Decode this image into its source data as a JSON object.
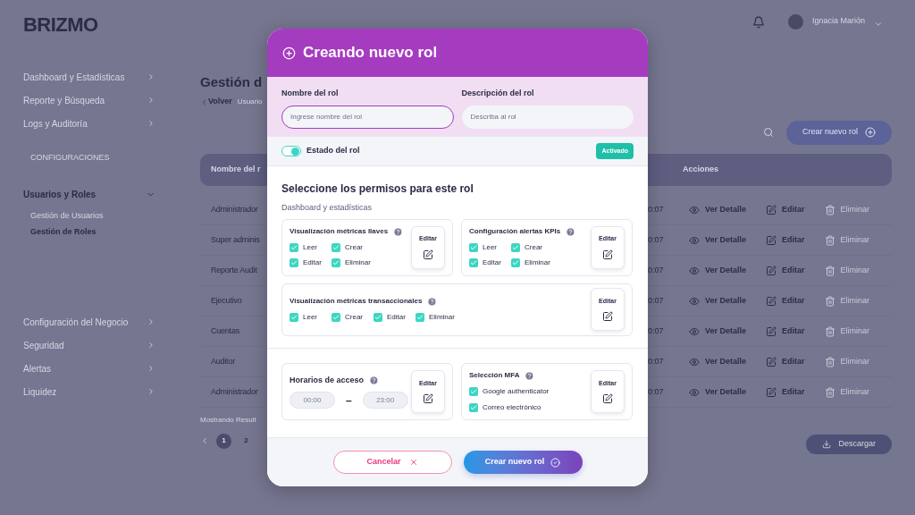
{
  "brand": "BRIZMO",
  "sidebar": {
    "items": [
      {
        "label": "Dashboard y Estadísticas"
      },
      {
        "label": "Reporte y Búsqueda"
      },
      {
        "label": "Logs y Auditoría"
      }
    ],
    "section": "CONFIGURACIONES",
    "group": {
      "label": "Usuarios y Roles",
      "expanded": true,
      "children": [
        {
          "label": "Gestión de Usuarios",
          "selected": false
        },
        {
          "label": "Gestión de Roles",
          "selected": true
        }
      ]
    },
    "more_items": [
      {
        "label": "Configuración del Negocio"
      },
      {
        "label": "Seguridad"
      },
      {
        "label": "Alertas"
      },
      {
        "label": "Liquidez"
      }
    ]
  },
  "user": {
    "name": "Ignacia Marión"
  },
  "page": {
    "title": "Gestión d",
    "back": "Volver",
    "breadcrumb": "Usuario",
    "create_button": "Crear nuevo rol",
    "download_button": "Descargar"
  },
  "table": {
    "columns": [
      "Nombre del r",
      "Acciones"
    ],
    "rows": [
      {
        "name": "Administrador",
        "time": "0:07",
        "actions": [
          {
            "label": "Ver Detalle",
            "kind": "view",
            "disabled": false
          },
          {
            "label": "Editar",
            "kind": "edit",
            "disabled": false
          },
          {
            "label": "Eliminar",
            "kind": "delete",
            "disabled": true
          }
        ]
      },
      {
        "name": "Super adminis",
        "time": "0:07",
        "actions": [
          {
            "label": "Ver Detalle",
            "kind": "view",
            "disabled": false
          },
          {
            "label": "Editar",
            "kind": "edit",
            "disabled": false
          },
          {
            "label": "Eliminar",
            "kind": "delete",
            "disabled": true
          }
        ]
      },
      {
        "name": "Reporte Audit",
        "time": "0:07",
        "actions": [
          {
            "label": "Ver Detalle",
            "kind": "view",
            "disabled": false
          },
          {
            "label": "Editar",
            "kind": "edit",
            "disabled": false
          },
          {
            "label": "Eliminar",
            "kind": "delete",
            "disabled": true
          }
        ]
      },
      {
        "name": "Ejecutivo",
        "time": "0:07",
        "actions": [
          {
            "label": "Ver Detalle",
            "kind": "view",
            "disabled": false
          },
          {
            "label": "Editar",
            "kind": "edit",
            "disabled": false
          },
          {
            "label": "Eliminar",
            "kind": "delete",
            "disabled": true
          }
        ]
      },
      {
        "name": "Cuentas",
        "time": "0:07",
        "actions": [
          {
            "label": "Ver Detalle",
            "kind": "view",
            "disabled": false
          },
          {
            "label": "Editar",
            "kind": "edit",
            "disabled": false
          },
          {
            "label": "Eliminar",
            "kind": "delete",
            "disabled": true
          }
        ]
      },
      {
        "name": "Auditor",
        "time": "0:07",
        "actions": [
          {
            "label": "Ver Detalle",
            "kind": "view",
            "disabled": false
          },
          {
            "label": "Editar",
            "kind": "edit",
            "disabled": false
          },
          {
            "label": "Eliminar",
            "kind": "delete",
            "disabled": true
          }
        ]
      },
      {
        "name": "Administrador",
        "time": "0:07",
        "actions": [
          {
            "label": "Ver Detalle",
            "kind": "view",
            "disabled": false
          },
          {
            "label": "Editar",
            "kind": "edit",
            "disabled": false
          },
          {
            "label": "Eliminar",
            "kind": "delete",
            "disabled": true
          }
        ]
      }
    ],
    "results": "Mostrando Result",
    "pages": [
      {
        "label": "1",
        "selected": true
      },
      {
        "label": "2",
        "selected": false
      }
    ]
  },
  "modal": {
    "title": "Creando nuevo rol",
    "fields": [
      {
        "label": "Nombre del rol",
        "placeholder": "Ingrese nombre del rol",
        "focused": true
      },
      {
        "label": "Descripción del rol",
        "placeholder": "Describa al rol",
        "focused": false
      }
    ],
    "status": {
      "label": "Estado del rol",
      "on": true,
      "badge": "Activado"
    },
    "permissions_title": "Seleccione los permisos para este rol",
    "group": "Dashboard y estadísticas",
    "cards": [
      {
        "title": "Visualización métricas llaves",
        "wide": false,
        "edit": "Editar",
        "options": [
          {
            "label": "Leer",
            "checked": true
          },
          {
            "label": "Crear",
            "checked": true
          },
          {
            "label": "Editar",
            "checked": true
          },
          {
            "label": "Eliminar",
            "checked": true
          }
        ]
      },
      {
        "title": "Configuración alertas KPIs",
        "wide": false,
        "edit": "Editar",
        "options": [
          {
            "label": "Leer",
            "checked": true
          },
          {
            "label": "Crear",
            "checked": true
          },
          {
            "label": "Editar",
            "checked": true
          },
          {
            "label": "Eliminar",
            "checked": true
          }
        ]
      },
      {
        "title": "Visualización métricas transaccionales",
        "wide": true,
        "edit": "Editar",
        "options": [
          {
            "label": "Leer",
            "checked": true
          },
          {
            "label": "Crear",
            "checked": true
          },
          {
            "label": "Editar",
            "checked": true
          },
          {
            "label": "Eliminar",
            "checked": true
          }
        ]
      }
    ],
    "hours": {
      "title": "Horarios de acceso",
      "from": "00:00",
      "separator": "–",
      "to": "23:00",
      "edit": "Editar"
    },
    "mfa": {
      "title": "Selección MFA",
      "edit": "Editar",
      "options": [
        {
          "label": "Google authenticator",
          "checked": true
        },
        {
          "label": "Correo electrónico",
          "checked": true
        }
      ]
    },
    "cancel": "Cancelar",
    "create": "Crear nuevo rol"
  }
}
